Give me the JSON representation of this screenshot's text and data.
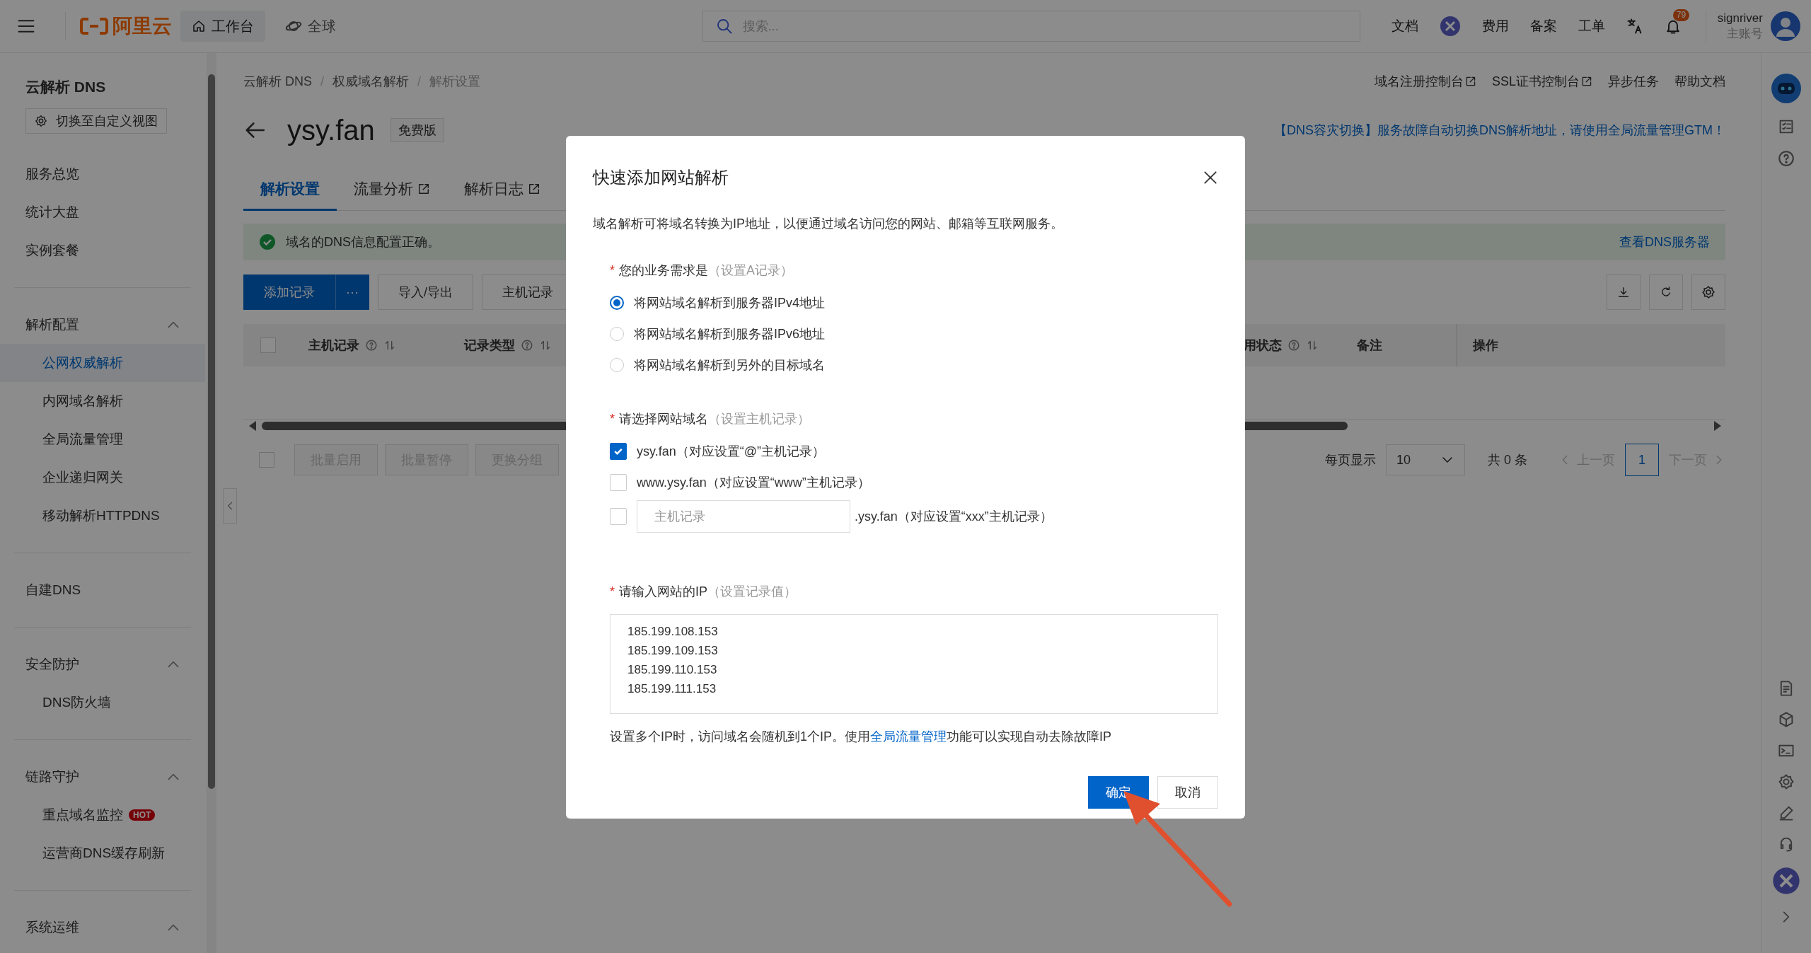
{
  "topbar": {
    "logo": "阿里云",
    "nav": [
      {
        "label": "工作台",
        "selected": true,
        "kind": "home"
      },
      {
        "label": "全球",
        "selected": false,
        "kind": "globe"
      }
    ],
    "search": {
      "placeholder": "搜索..."
    },
    "actions": [
      {
        "kind": "link",
        "label": "文档"
      },
      {
        "kind": "app"
      },
      {
        "kind": "link",
        "label": "费用"
      },
      {
        "kind": "link",
        "label": "备案"
      },
      {
        "kind": "link",
        "label": "工单"
      },
      {
        "kind": "translate"
      },
      {
        "kind": "bell",
        "badge": "79"
      }
    ],
    "user": {
      "name": "signriver",
      "role": "主账号"
    }
  },
  "sidebar": {
    "title": "云解析 DNS",
    "view_button": "切换至自定义视图",
    "groups": [
      {
        "items": [
          {
            "label": "服务总览",
            "selected": false
          },
          {
            "label": "统计大盘",
            "selected": false
          },
          {
            "label": "实例套餐",
            "selected": false
          }
        ]
      },
      {
        "title": "解析配置",
        "expanded": true,
        "items": [
          {
            "label": "公网权威解析",
            "selected": true
          },
          {
            "label": "内网域名解析",
            "selected": false
          },
          {
            "label": "全局流量管理",
            "selected": false
          },
          {
            "label": "企业递归网关",
            "selected": false
          },
          {
            "label": "移动解析HTTPDNS",
            "selected": false
          }
        ]
      },
      {
        "items": [
          {
            "label": "自建DNS",
            "selected": false
          }
        ]
      },
      {
        "title": "安全防护",
        "expanded": true,
        "items": [
          {
            "label": "DNS防火墙",
            "selected": false
          }
        ]
      },
      {
        "title": "链路守护",
        "expanded": true,
        "items": [
          {
            "label": "重点域名监控",
            "selected": false,
            "badge": "HOT"
          },
          {
            "label": "运营商DNS缓存刷新",
            "selected": false
          }
        ]
      },
      {
        "title": "系统运维",
        "expanded": true
      }
    ]
  },
  "main": {
    "breadcrumb": [
      "云解析 DNS",
      "权威域名解析",
      "解析设置"
    ],
    "breadcrumb_separator": "/",
    "select_all_checked": false,
    "batch_select_checked": false,
    "top_links": [
      {
        "label": "域名注册控制台",
        "external": true
      },
      {
        "label": "SSL证书控制台",
        "external": true
      },
      {
        "label": "异步任务",
        "external": false
      },
      {
        "label": "帮助文档",
        "external": false
      }
    ],
    "domain": "ysy.fan",
    "edition": "免费版",
    "promo": "【DNS容灾切换】服务故障自动切换DNS解析地址，请使用全局流量管理GTM！",
    "tabs": [
      {
        "label": "解析设置",
        "selected": true,
        "external": false
      },
      {
        "label": "流量分析",
        "selected": false,
        "external": true
      },
      {
        "label": "解析日志",
        "selected": false,
        "external": true
      }
    ],
    "alert": {
      "text": "域名的DNS信息配置正确。",
      "link": "查看DNS服务器"
    },
    "toolbar": {
      "primary": "添加记录",
      "more": "···",
      "buttons": [
        "导入/导出",
        "主机记录"
      ]
    },
    "table": {
      "columns": [
        {
          "label": "主机记录",
          "help": true,
          "sortable": true
        },
        {
          "label": "记录类型",
          "help": true,
          "sortable": true
        },
        {
          "label": "用状态",
          "help": true,
          "sortable": true
        },
        {
          "label": "备注",
          "help": false,
          "sortable": false
        },
        {
          "label": "操作",
          "help": false,
          "sortable": false
        }
      ]
    },
    "batch_buttons": [
      {
        "label": "批量启用",
        "disabled": true
      },
      {
        "label": "批量暂停",
        "disabled": true
      },
      {
        "label": "更换分组",
        "disabled": true
      }
    ],
    "pagination": {
      "per_page_label": "每页显示",
      "per_page": "10",
      "total": "共 0 条",
      "prev": {
        "label": "上一页",
        "disabled": true
      },
      "next": {
        "label": "下一页",
        "disabled": true
      },
      "pages": [
        {
          "label": "1",
          "selected": true
        }
      ]
    }
  },
  "modal": {
    "title": "快速添加网站解析",
    "required_mark": "*",
    "description": "域名解析可将域名转换为IP地址，以便通过域名访问您的网站、邮箱等互联网服务。",
    "sections": [
      {
        "kind": "radio",
        "required": true,
        "label": "您的业务需求是",
        "hint": "（设置A记录）",
        "options": [
          {
            "label": "将网站域名解析到服务器IPv4地址",
            "selected": true
          },
          {
            "label": "将网站域名解析到服务器IPv6地址",
            "selected": false
          },
          {
            "label": "将网站域名解析到另外的目标域名",
            "selected": false
          }
        ]
      },
      {
        "kind": "checkbox",
        "required": true,
        "label": "请选择网站域名",
        "hint": "（设置主机记录）",
        "options": [
          {
            "kind": "fixed",
            "label": "ysy.fan（对应设置“@”主机记录）",
            "checked": true
          },
          {
            "kind": "fixed",
            "label": "www.ysy.fan（对应设置“www”主机记录）",
            "checked": false
          },
          {
            "kind": "custom",
            "placeholder": "主机记录",
            "suffix": ".ysy.fan（对应设置“xxx”主机记录）",
            "checked": false
          }
        ]
      },
      {
        "kind": "textarea",
        "required": true,
        "label": "请输入网站的IP",
        "hint": "（设置记录值）",
        "value": "185.199.108.153\n185.199.109.153\n185.199.110.153\n185.199.111.153"
      }
    ],
    "note": {
      "before": "设置多个IP时，访问域名会随机到1个IP。使用",
      "link": "全局流量管理",
      "after": "功能可以实现自动去除故障IP"
    },
    "buttons": [
      {
        "kind": "primary",
        "label": "确定"
      },
      {
        "kind": "default",
        "label": "取消"
      }
    ]
  }
}
